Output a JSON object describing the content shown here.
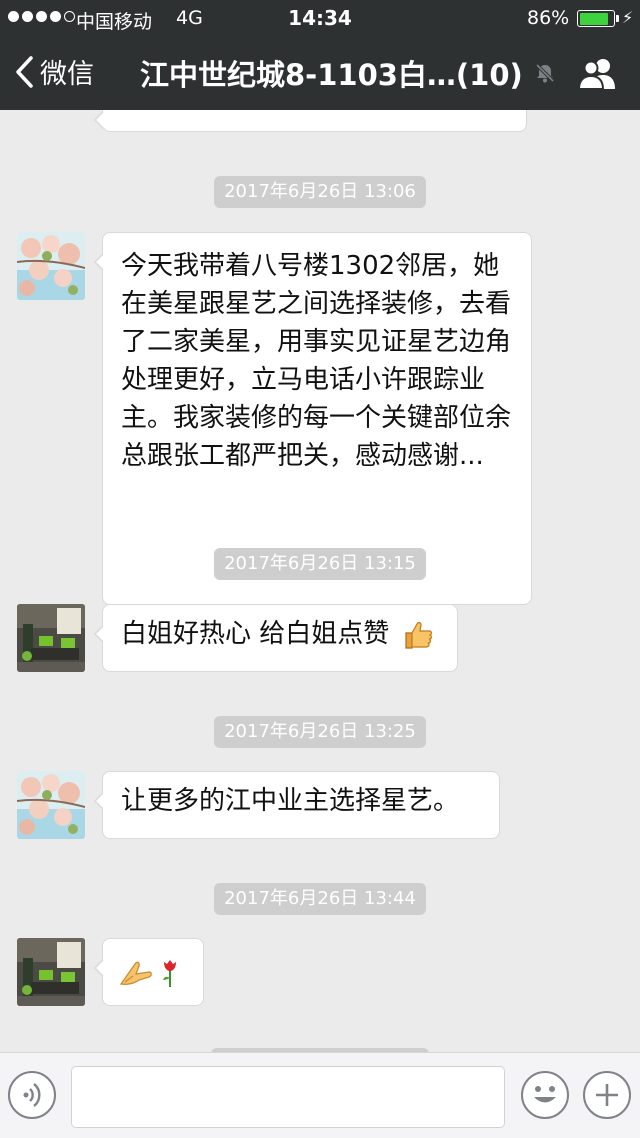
{
  "status_bar": {
    "carrier": "中国移动",
    "network": "4G",
    "time": "14:34",
    "battery_percent": "86%",
    "battery_level": 0.86,
    "battery_color": "#3ed33e"
  },
  "nav": {
    "back_label": "微信",
    "title": "江中世纪城8-1103白…(10)",
    "muted_icon": "bell-muted-icon",
    "group_icon": "group-members-icon"
  },
  "messages": [
    {
      "type": "timestamp",
      "text": "2017年6月26日 13:06"
    },
    {
      "type": "text",
      "sender": "flower-avatar",
      "text": "今天我带着八号楼1302邻居，她在美星跟星艺之间选择装修，去看了二家美星，用事实见证星艺边角处理更好，立马电话小许跟踪业主。我家装修的每一个关键部位余总跟张工都严把关，感动感谢..."
    },
    {
      "type": "timestamp",
      "text": "2017年6月26日 13:15"
    },
    {
      "type": "text",
      "sender": "room-avatar",
      "text": "白姐好热心 给白姐点赞",
      "emoji": "thumbs-up-icon"
    },
    {
      "type": "timestamp",
      "text": "2017年6月26日 13:25"
    },
    {
      "type": "text",
      "sender": "flower-avatar",
      "text": "让更多的江中业主选择星艺。"
    },
    {
      "type": "timestamp",
      "text": "2017年6月26日 13:44"
    },
    {
      "type": "emoji",
      "sender": "room-avatar",
      "emoji": [
        "praying-hands-icon",
        "rose-icon"
      ]
    }
  ],
  "input_bar": {
    "voice_icon": "voice-icon",
    "emoji_icon": "smiley-icon",
    "plus_icon": "plus-icon",
    "placeholder": ""
  },
  "colors": {
    "nav_background": "#2e3132",
    "chat_background": "#ebebeb",
    "timestamp_background": "#cecece"
  }
}
